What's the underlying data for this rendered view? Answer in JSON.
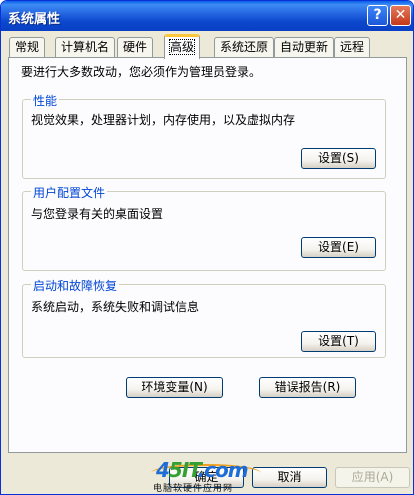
{
  "window": {
    "title": "系统属性"
  },
  "titlebar": {
    "help_icon": "?",
    "close_icon": "✕"
  },
  "tabs": [
    {
      "label": "常规"
    },
    {
      "label": "计算机名"
    },
    {
      "label": "硬件"
    },
    {
      "label": "高级"
    },
    {
      "label": "系统还原"
    },
    {
      "label": "自动更新"
    },
    {
      "label": "远程"
    }
  ],
  "panel": {
    "notice": "要进行大多数改动，您必须作为管理员登录。",
    "performance": {
      "title": "性能",
      "description": "视觉效果，处理器计划，内存使用，以及虚拟内存",
      "button": "设置(S)"
    },
    "user_profiles": {
      "title": "用户配置文件",
      "description": "与您登录有关的桌面设置",
      "button": "设置(E)"
    },
    "startup_recovery": {
      "title": "启动和故障恢复",
      "description": "系统启动，系统失败和调试信息",
      "button": "设置(T)"
    },
    "env_button": "环境变量(N)",
    "error_report_button": "错误报告(R)"
  },
  "footer": {
    "ok_button": "确定",
    "cancel_button": "取消",
    "apply_button": "应用(A)"
  },
  "watermark": {
    "logo_part1": "4",
    "logo_part2": "5IT",
    "logo_part3": ".com",
    "subtitle": "电脑软硬件应用网"
  }
}
